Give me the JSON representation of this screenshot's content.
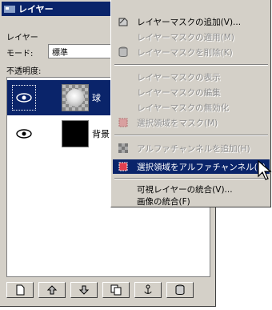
{
  "window": {
    "title": "レイヤー"
  },
  "panel": {
    "layer_label": "レイヤー",
    "mode_label": "モード:",
    "mode_value": "標準",
    "opacity_label": "不透明度:"
  },
  "layers": [
    {
      "name": "球",
      "selected": true,
      "visible": true
    },
    {
      "name": "背景",
      "selected": false,
      "visible": true
    }
  ],
  "menu": {
    "items": [
      {
        "label": "レイヤーマスクの追加(V)...",
        "enabled": true,
        "icon": "add-mask-icon"
      },
      {
        "label": "レイヤーマスクの適用(M)",
        "enabled": false,
        "icon": ""
      },
      {
        "label": "レイヤーマスクを削除(K)",
        "enabled": false,
        "icon": "delete-mask-icon"
      },
      {
        "label": "レイヤーマスクの表示",
        "enabled": false,
        "icon": ""
      },
      {
        "label": "レイヤーマスクの編集",
        "enabled": false,
        "icon": ""
      },
      {
        "label": "レイヤーマスクの無効化",
        "enabled": false,
        "icon": ""
      },
      {
        "label": "選択領域をマスク(M)",
        "enabled": false,
        "icon": "mask-to-selection-icon"
      },
      {
        "label": "アルファチャンネルを追加(H)",
        "enabled": false,
        "icon": "add-alpha-icon"
      },
      {
        "label": "選択領域をアルファチャンネル(P)",
        "enabled": true,
        "highlighted": true,
        "icon": "alpha-to-selection-icon"
      },
      {
        "label": "可視レイヤーの統合(V)...",
        "enabled": true,
        "icon": ""
      },
      {
        "label": "画像の統合(F)",
        "enabled": true,
        "icon": ""
      }
    ]
  },
  "toolbar": {
    "buttons": [
      "new-layer-icon",
      "raise-layer-icon",
      "lower-layer-icon",
      "duplicate-layer-icon",
      "anchor-layer-icon",
      "delete-layer-icon"
    ]
  },
  "colors": {
    "selection": "#0a246a",
    "face": "#d4d0c8",
    "disabled_text": "#8f8f8f"
  }
}
